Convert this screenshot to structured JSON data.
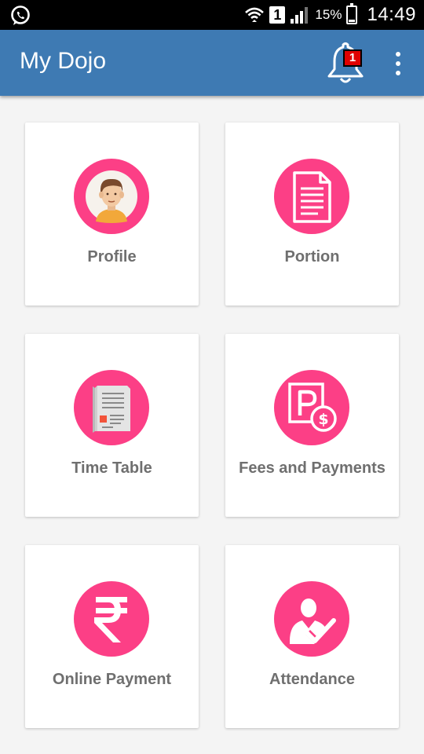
{
  "status_bar": {
    "left_icon": "whatsapp-icon",
    "icons": [
      "wifi-icon",
      "sim-icon",
      "signal-icon",
      "battery-icon"
    ],
    "sim_slot": "1",
    "battery_percent": "15%",
    "battery_level": 0.15,
    "time": "14:49"
  },
  "app_bar": {
    "title": "My Dojo",
    "notification_count": "1",
    "bell_icon": "bell-icon",
    "menu_icon": "overflow-menu-icon"
  },
  "colors": {
    "app_bar": "#3e7ab3",
    "circle": "#fc3f86",
    "label": "#6f6f6f",
    "background": "#f4f4f4",
    "badge": "#e00000"
  },
  "tiles": [
    {
      "label": "Profile",
      "icon": "profile-avatar-icon"
    },
    {
      "label": "Portion",
      "icon": "document-icon"
    },
    {
      "label": "Time Table",
      "icon": "timetable-icon"
    },
    {
      "label": "Fees and Payments",
      "icon": "fees-payment-icon"
    },
    {
      "label": "Online Payment",
      "icon": "rupee-icon"
    },
    {
      "label": "Attendance",
      "icon": "attendance-icon"
    }
  ]
}
